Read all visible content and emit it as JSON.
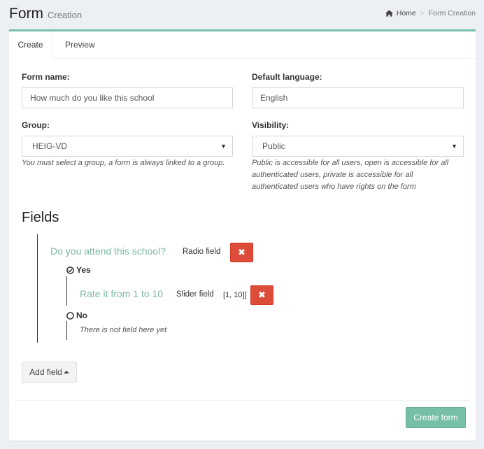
{
  "header": {
    "title": "Form",
    "subtitle": "Creation",
    "breadcrumb": {
      "home": "Home",
      "current": "Form Creation"
    }
  },
  "tabs": [
    {
      "label": "Create",
      "active": true
    },
    {
      "label": "Preview",
      "active": false
    }
  ],
  "form": {
    "name_label": "Form name:",
    "name_value": "How much do you like this school",
    "language_label": "Default language:",
    "language_value": "English",
    "group_label": "Group:",
    "group_value": "HEIG-VD",
    "group_help": "You must select a group, a form is always linked to a group.",
    "visibility_label": "Visibility:",
    "visibility_value": "Public",
    "visibility_help_lines": [
      "Public is accessible for all users, open is accessible for all",
      "authenticated users, private is accessible for all",
      "authenticated users who have rights on the form"
    ]
  },
  "fields": {
    "title": "Fields",
    "q1": {
      "title": "Do you attend this school?",
      "type": "Radio field",
      "delete_icon": "✖",
      "choices": [
        {
          "label": "Yes",
          "checked": true,
          "sub_field": {
            "title": "Rate it from 1 to 10",
            "type": "Slider field",
            "range": "[1, 10]]",
            "delete_icon": "✖"
          }
        },
        {
          "label": "No",
          "checked": false,
          "empty_note": "There is not field here yet"
        }
      ]
    },
    "add_button": "Add field"
  },
  "actions": {
    "create_button": "Create form"
  },
  "colors": {
    "accent": "#77bfa8",
    "danger": "#dd4b39",
    "background": "#ecf0f5"
  },
  "icons": {
    "home": "home-icon",
    "check": "check-circle-icon",
    "radio": "circle-icon",
    "delete": "times-icon",
    "caret": "caret-up-icon"
  }
}
